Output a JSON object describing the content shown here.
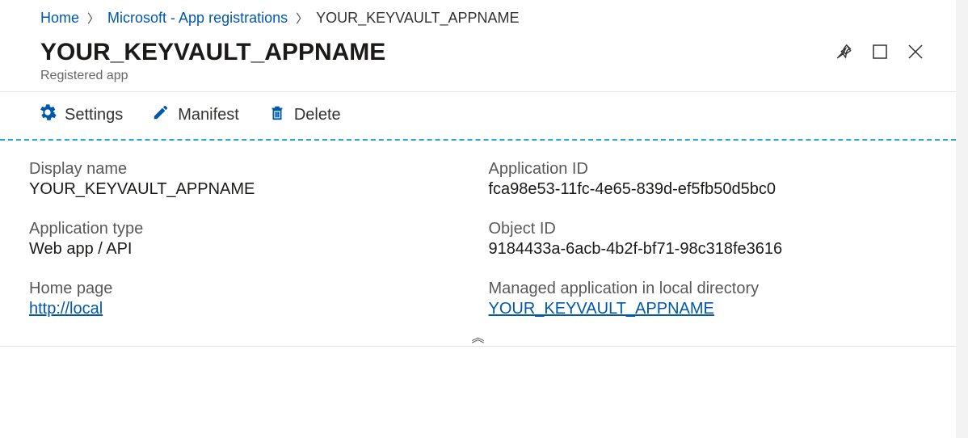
{
  "breadcrumb": {
    "home": "Home",
    "parent": "Microsoft - App registrations",
    "current": "YOUR_KEYVAULT_APPNAME"
  },
  "header": {
    "title": "YOUR_KEYVAULT_APPNAME",
    "subtitle": "Registered app"
  },
  "toolbar": {
    "settings": "Settings",
    "manifest": "Manifest",
    "delete": "Delete"
  },
  "fields": {
    "display_name": {
      "label": "Display name",
      "value": "YOUR_KEYVAULT_APPNAME"
    },
    "application_id": {
      "label": "Application ID",
      "value": "fca98e53-11fc-4e65-839d-ef5fb50d5bc0"
    },
    "application_type": {
      "label": "Application type",
      "value": "Web app / API"
    },
    "object_id": {
      "label": "Object ID",
      "value": "9184433a-6acb-4b2f-bf71-98c318fe3616"
    },
    "home_page": {
      "label": "Home page",
      "value": "http://local"
    },
    "managed_app": {
      "label": "Managed application in local directory",
      "value": "YOUR_KEYVAULT_APPNAME"
    }
  },
  "expand_glyph": "︽"
}
